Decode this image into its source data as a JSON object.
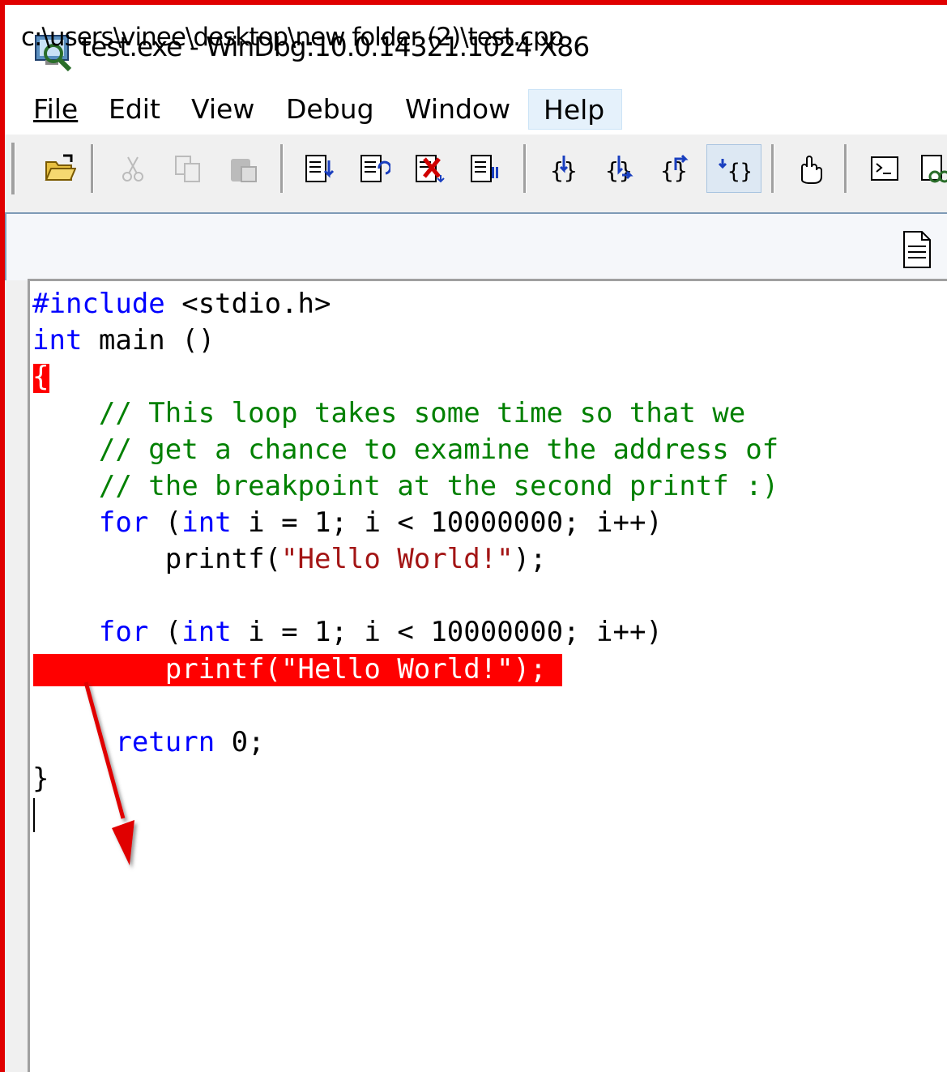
{
  "window": {
    "title": "test.exe - WinDbg:10.0.14321.1024 X86"
  },
  "menu": {
    "items": [
      {
        "label": "File"
      },
      {
        "label": "Edit"
      },
      {
        "label": "View"
      },
      {
        "label": "Debug"
      },
      {
        "label": "Window"
      },
      {
        "label": "Help"
      }
    ]
  },
  "toolbar": {
    "buttons": [
      {
        "name": "open-icon"
      },
      {
        "name": "cut-icon"
      },
      {
        "name": "copy-icon"
      },
      {
        "name": "paste-icon"
      },
      {
        "name": "go-icon"
      },
      {
        "name": "restart-icon"
      },
      {
        "name": "stop-debugging-icon"
      },
      {
        "name": "break-icon"
      },
      {
        "name": "step-into-icon"
      },
      {
        "name": "step-over-icon"
      },
      {
        "name": "step-out-icon"
      },
      {
        "name": "run-to-cursor-icon"
      },
      {
        "name": "source-mode-icon"
      },
      {
        "name": "command-window-icon"
      },
      {
        "name": "watch-window-icon"
      }
    ]
  },
  "document": {
    "path": "c:\\users\\vinee\\desktop\\new folder (2)\\test.cpp"
  },
  "code": {
    "l1_kw": "#include",
    "l1_rest": " <stdio.h>",
    "l2_kw": "int",
    "l2_rest": " main ()",
    "l3": "{",
    "l4": "    // This loop takes some time so that we",
    "l5": "    // get a chance to examine the address of",
    "l6": "    // the breakpoint at the second printf :)",
    "l7_indent": "    ",
    "l7_for": "for",
    "l7_paren": " (",
    "l7_int": "int",
    "l7_rest": " i = 1; i < 10000000; i++)",
    "l8_a": "        printf(",
    "l8_str": "\"Hello World!\"",
    "l8_b": ");",
    "l10_indent": "    ",
    "l10_for": "for",
    "l10_paren": " (",
    "l10_int": "int",
    "l10_rest": " i = 1; i < 10000000; i++)",
    "l11": "        printf(\"Hello World!\");",
    "l13_indent": "     ",
    "l13_kw": "return",
    "l13_rest": " 0;",
    "l14": "}"
  },
  "colors": {
    "keyword": "#0000ff",
    "comment": "#008000",
    "string": "#a31515",
    "breakpoint": "#ff0000",
    "annotation_arrow": "#e00000"
  }
}
